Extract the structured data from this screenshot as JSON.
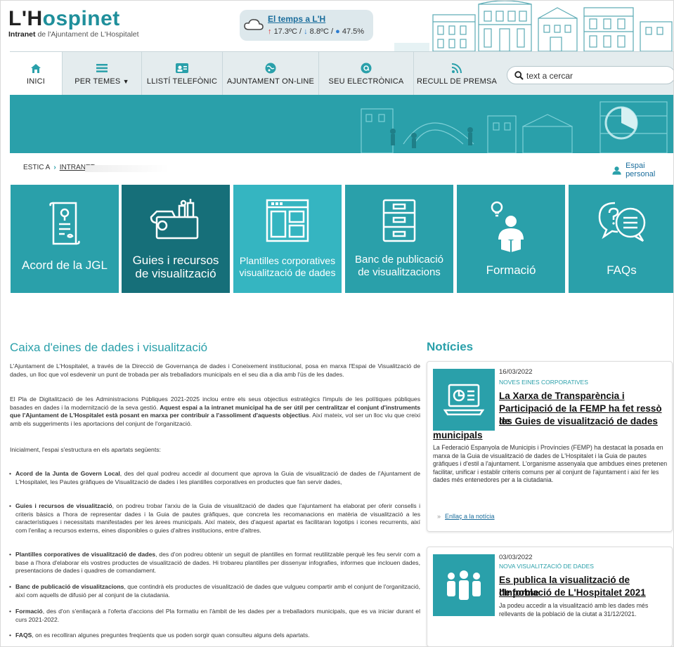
{
  "header": {
    "logo_main": "L'Hospinet",
    "logo_sub_a": "Intranet",
    "logo_sub_b": "de l'Ajuntament de L'Hospitalet"
  },
  "weather": {
    "title": "El temps a L'H",
    "max": "17.3ºC",
    "min": "8.8ºC",
    "humidity": "47.5%"
  },
  "nav": {
    "items": [
      {
        "label": "INICI",
        "icon": "home-icon"
      },
      {
        "label": "PER TEMES",
        "icon": "list-icon"
      },
      {
        "label": "LLISTÍ TELEFÒNIC",
        "icon": "contact-card-icon"
      },
      {
        "label": "AJUNTAMENT ON-LINE",
        "icon": "globe-icon"
      },
      {
        "label": "SEU ELECTRÒNICA",
        "icon": "at-icon"
      },
      {
        "label": "RECULL DE PREMSA",
        "icon": "rss-icon"
      }
    ],
    "search_placeholder": "text a cercar"
  },
  "breadcrumb": {
    "prefix": "ESTIC A",
    "current": "INTRANET"
  },
  "personal_space": "Espai personal",
  "tiles": [
    {
      "line1": "Acord de la JGL",
      "line2": "",
      "icon": "document-seal-icon"
    },
    {
      "line1": "Guies i recursos",
      "line2": "de visualització",
      "icon": "toolbox-icon"
    },
    {
      "line1": "Plantilles corporatives",
      "line2": "visualització de dades",
      "icon": "template-icon"
    },
    {
      "line1": "Banc de publicació",
      "line2": "de visualitzacions",
      "icon": "filing-cabinet-icon"
    },
    {
      "line1": "Formació",
      "line2": "",
      "icon": "reader-idea-icon"
    },
    {
      "line1": "FAQs",
      "line2": "",
      "icon": "chat-bubbles-icon"
    }
  ],
  "main": {
    "title": "Caixa d'eines de dades i visualització",
    "p1": "L'Ajuntament de L'Hospitalet, a través de la Direcció de Governança de dades i Coneixement institucional, posa en marxa l'Espai de Visualització de dades, un lloc que vol esdevenir un punt de trobada per als treballadors municipals en el seu dia a dia amb l'ús de les dades.",
    "p2a": "El Pla de Digitalització de les Administracions Públiques 2021-2025 inclou entre els seus objectius estratègics l'impuls de les polítiques públiques basades en dades i la modernització de la seva gestió. ",
    "p2b": "Aquest espai a la intranet municipal ha de ser útil per centralitzar el conjunt d'instruments que l'Ajuntament de L'Hospitalet està posant en marxa per contribuir a l'assoliment d'aquests objectius",
    "p2c": ". Així mateix, vol ser un lloc viu que creixi amb els suggeriments i les aportacions del conjunt de l'organització.",
    "p3": "Inicialment, l'espai s'estructura en els apartats següents:",
    "bullets": [
      {
        "bold": "Acord de la Junta de Govern Local",
        "text": ", des del qual podreu accedir al document que aprova la Guia de visualització de dades de l'Ajuntament de L'Hospitalet, les Pautes gràfiques de Visualització de dades i les plantilles corporatives en productes que fan servir dades,"
      },
      {
        "bold": "Guies i recursos de visualització",
        "text": ", on podreu trobar l'arxiu de la Guia de visualització de dades que l'ajuntament ha elaborat per oferir consells i criteris bàsics a l'hora de representar dades i la Guia de pautes gràfiques, que concreta les recomanacions en matèria de visualització a les característiques i necessitats manifestades per les àrees municipals. Així mateix, des d'aquest apartat es facilitaran logotips i icones recurrents, així com l'enllaç a recursos externs, eines disponibles o guies d'altres institucions, entre d'altres."
      },
      {
        "bold": "Plantilles corporatives de visualització de dades",
        "text": ", des d'on podreu obtenir un seguit de plantilles en format reutilitzable perquè les feu servir com a base a l'hora d'elaborar els vostres productes de visualització de dades. Hi trobareu plantilles per dissenyar infografies, informes que inclouen dades, presentacions de dades i quadres de comandament."
      },
      {
        "bold": "Banc de publicació de visualitzacions",
        "text": ", que contindrà els productes de visualització de dades que vulgueu compartir amb el conjunt de l'organització, així com aquells de difusió per al conjunt de la ciutadania."
      },
      {
        "bold": "Formació",
        "text": ", des d'on s'enllaçarà a l'oferta d'accions del Pla formatiu en l'àmbit de les dades per a treballadors municipals, que es va iniciar durant el curs 2021-2022."
      },
      {
        "bold": "FAQS",
        "text": ", on es recolliran algunes preguntes freqüents que us poden sorgir quan consulteu alguns dels apartats."
      }
    ]
  },
  "news": {
    "title": "Notícies",
    "items": [
      {
        "date": "16/03/2022",
        "category": "NOVES EINES CORPORATIVES",
        "title_l1": "La Xarxa de Transparència i",
        "title_l2": "Participació de la FEMP ha fet ressò de",
        "title_l3": "les Guies de visualització de dades",
        "title_l4": "municipals",
        "body": "La Federació Espanyola de Municipis i Províncies (FEMP) ha destacat la posada en marxa de la Guia de visualització de dades de L'Hospitalet i la Guia de pautes gràfiques i d'estil a l'ajuntament. L'organisme assenyala que ambdues eines pretenen facilitar, unificar i establir criteris comuns per al conjunt de l'ajuntament i així fer les dades més entenedores per a la ciutadania.",
        "link": "Enllaç a la notícia",
        "icon": "laptop-chart-icon"
      },
      {
        "date": "03/03/2022",
        "category": "NOVA VISUALITZACIÓ DE DADES",
        "title_l1": "Es publica la visualització de l'Informe",
        "title_l2": "de població de L'Hospitalet 2021",
        "body": "Ja podeu accedir a la visualització amb les dades més rellevants de la població de la ciutat a 31/12/2021.",
        "icon": "population-icon"
      }
    ]
  },
  "colors": {
    "teal": "#2aa0aa",
    "teal_dark": "#166f79",
    "teal_light": "#35b5c1",
    "nav_bg": "#e4ecee"
  }
}
